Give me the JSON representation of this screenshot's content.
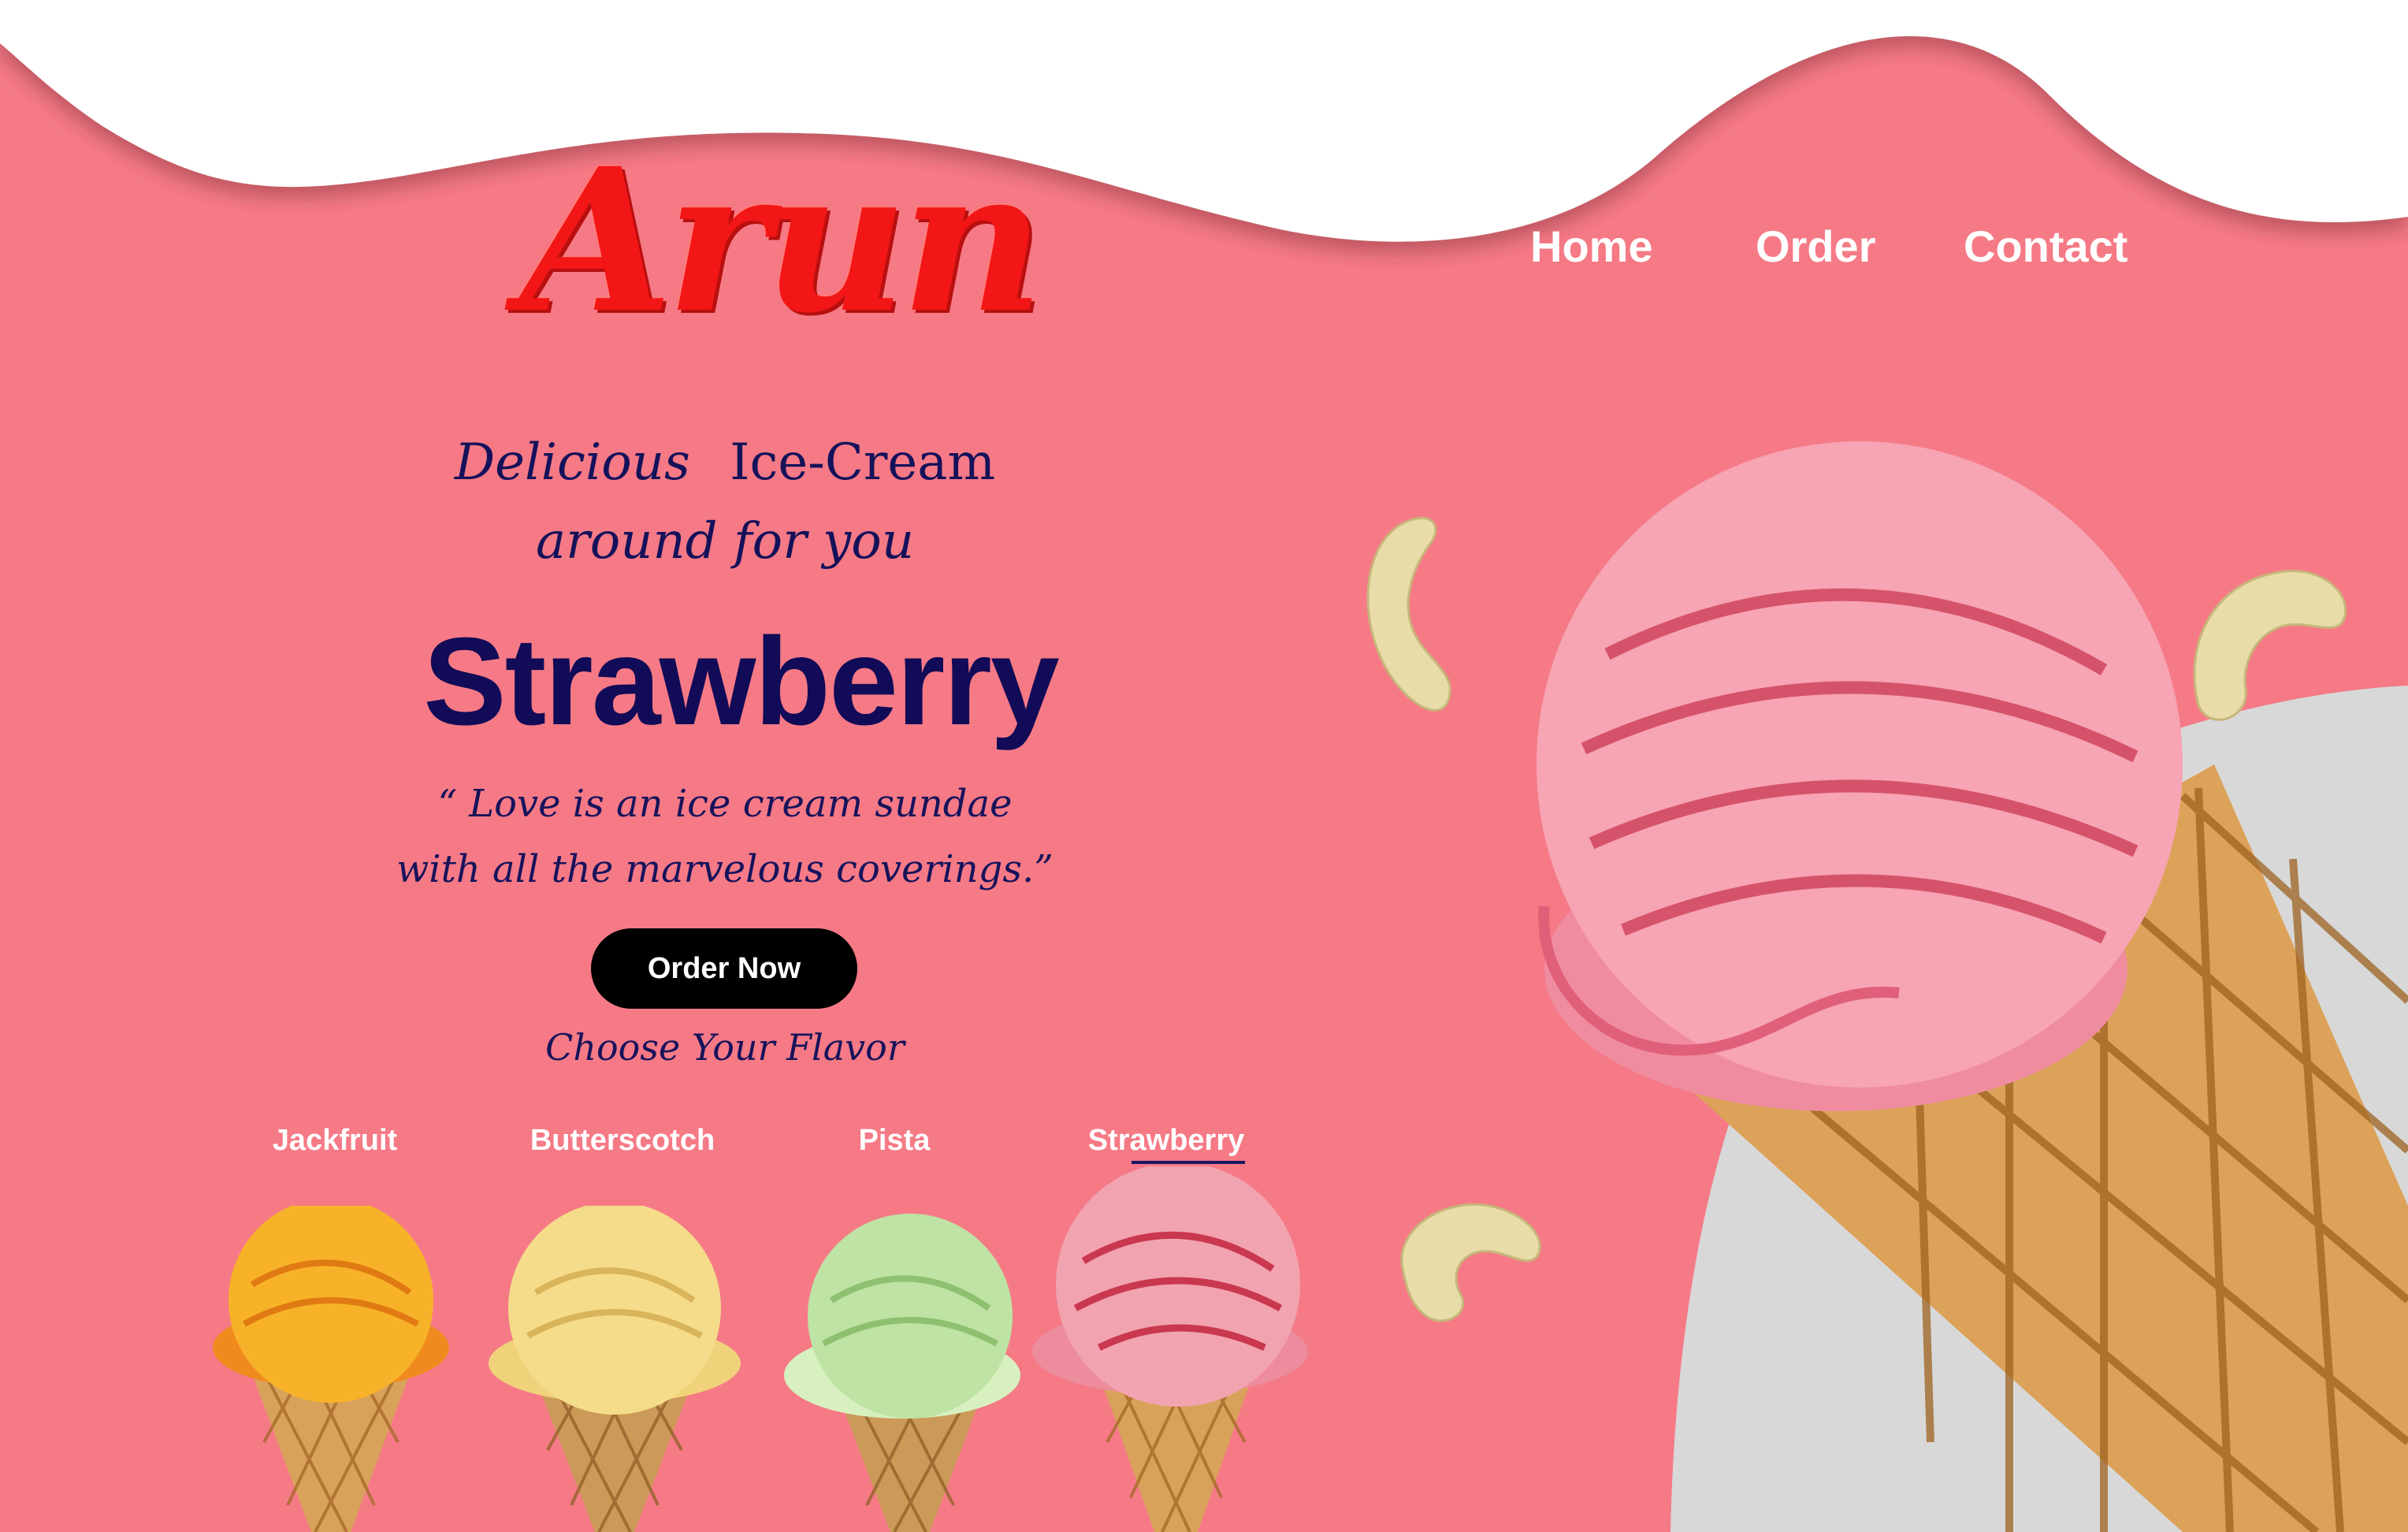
{
  "brand": {
    "logo_text": "Arun"
  },
  "nav": {
    "items": [
      "Home",
      "Order",
      "Contact"
    ]
  },
  "hero": {
    "tagline_line1_a": "Delicious",
    "tagline_line1_b": "Ice-Cream",
    "tagline_line2": "around for you",
    "flavor_title": "Strawberry",
    "quote_line1": "“ Love is an ice cream sundae",
    "quote_line2": "with all the marvelous coverings.”",
    "cta_label": "Order Now",
    "choose_label": "Choose Your Flavor"
  },
  "flavors": [
    {
      "name": "Jackfruit",
      "color": "#f5a623"
    },
    {
      "name": "Butterscotch",
      "color": "#f3d27a"
    },
    {
      "name": "Pista",
      "color": "#bfe3a4"
    },
    {
      "name": "Strawberry",
      "color": "#f2a3b0",
      "selected": true
    }
  ],
  "colors": {
    "background": "#f57a86",
    "accent_red": "#f21616",
    "navy": "#120b57",
    "grey_blob": "#d8d8d8"
  }
}
